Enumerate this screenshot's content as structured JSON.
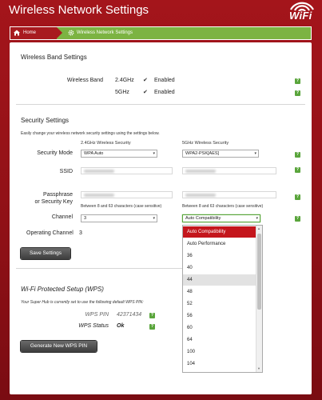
{
  "header": {
    "title": "Wireless Network Settings",
    "logo_text": "WiFi"
  },
  "nav": {
    "home_label": "Home",
    "current_label": "Wireless Network Settings"
  },
  "band": {
    "section_title": "Wireless Band Settings",
    "label": "Wireless Band",
    "rows": [
      {
        "freq": "2.4GHz",
        "status": "Enabled",
        "checked": true
      },
      {
        "freq": "5GHz",
        "status": "Enabled",
        "checked": true
      }
    ]
  },
  "security": {
    "section_title": "Security Settings",
    "description": "Easily change your wireless network security settings using the settings below.",
    "col_24_title": "2.4GHz Wireless Security",
    "col_5_title": "5GHz Wireless Security",
    "mode_label": "Security Mode",
    "mode_24": "WPA Auto",
    "mode_5": "WPA2-PSK[AES]",
    "ssid_label": "SSID",
    "pass_label_1": "Passphrase",
    "pass_label_2": "or Security Key",
    "pass_hint_24": "Between 8 and 63 characters (case sensitive)",
    "pass_hint_5": "Between 8 and 63 characters (case sensitive)",
    "channel_label": "Channel",
    "channel_24": "3",
    "channel_5": "Auto Compatibility",
    "op_channel_label": "Operating Channel",
    "op_channel_value": "3",
    "save_label": "Save Settings"
  },
  "channel_dropdown": {
    "selected": "Auto Compatibility",
    "hovered": "44",
    "options": [
      "Auto Compatibility",
      "Auto Performance",
      "36",
      "40",
      "44",
      "48",
      "52",
      "56",
      "60",
      "64",
      "100",
      "104"
    ]
  },
  "wps": {
    "section_title": "Wi-Fi Protected Setup (WPS)",
    "description": "Your Super Hub is currently set to use the following default WPS PIN:",
    "pin_label": "WPS PIN",
    "pin_value": "42371434",
    "status_label": "WPS Status",
    "status_value": "Ok",
    "generate_label": "Generate New WPS PIN"
  },
  "colors": {
    "brand_red": "#a4151b",
    "accent_green": "#7cb342",
    "help_green": "#5aa53c"
  },
  "icons": {
    "help": "help-icon",
    "checkbox": "checkbox-checked-icon",
    "home": "home-icon",
    "gear": "gear-icon"
  }
}
